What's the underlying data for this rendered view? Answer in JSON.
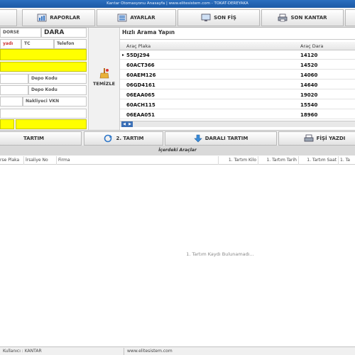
{
  "window": {
    "title": "Kantar Otomasyonu Anasayfa | www.elitesistem.com - TOKAT-DEREYAKA"
  },
  "toolbar": {
    "buttons": [
      {
        "label": "RAPORLAR",
        "icon": "report-icon"
      },
      {
        "label": "AYARLAR",
        "icon": "settings-icon"
      },
      {
        "label": "SON FİŞ",
        "icon": "monitor-icon"
      },
      {
        "label": "SON KANTAR",
        "icon": "printer-icon"
      }
    ]
  },
  "left_form": {
    "dorse_label": "DORSE",
    "dara_label": "DARA",
    "col_adi": "yadı",
    "col_tc": "TC",
    "col_telefon": "Telefon",
    "depo_kodu_1": "Depo Kodu",
    "depo_kodu_2": "Depo Kodu",
    "nakliyeci_vkn": "Nakliyeci VKN"
  },
  "clear_button": {
    "label": "TEMİZLE"
  },
  "quick_search": {
    "label": "Hızlı Arama Yapın",
    "columns": {
      "plaka": "Araç Plaka",
      "dara": "Araç Dara"
    },
    "rows": [
      {
        "plaka": "55DJ294",
        "dara": "14120",
        "current": true
      },
      {
        "plaka": "60ACT366",
        "dara": "14520",
        "current": false
      },
      {
        "plaka": "60AEM126",
        "dara": "14060",
        "current": false
      },
      {
        "plaka": "06GD4161",
        "dara": "14640",
        "current": false
      },
      {
        "plaka": "06EAA065",
        "dara": "19020",
        "current": false
      },
      {
        "plaka": "60ACH115",
        "dara": "15540",
        "current": false
      },
      {
        "plaka": "06EAA051",
        "dara": "18960",
        "current": false
      }
    ],
    "current_marker": "▸"
  },
  "actions": {
    "tartim1": "TARTIM",
    "tartim2": "2. TARTIM",
    "darali": "DARALI TARTIM",
    "fisi_yazdir": "FİŞİ YAZDI"
  },
  "inside_vehicles": {
    "title": "İçerdeki Araçlar",
    "columns": [
      "rse Plaka",
      "İrsaliye No",
      "Firma",
      "1. Tartım Kilo",
      "1. Tartım Tarih",
      "1. Tartım Saat",
      "1. Ta"
    ],
    "empty_message": "1. Tartım Kaydı Bulunamadı..."
  },
  "status": {
    "user": "Kullanıcı : KANTAR",
    "website": "www.elitesistem.com"
  },
  "colors": {
    "highlight_yellow": "#ffff00",
    "title_blue": "#1c5aa6"
  }
}
